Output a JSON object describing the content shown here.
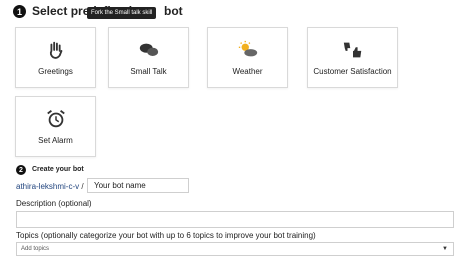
{
  "step1": {
    "number": "1",
    "title_start": "Select predefined",
    "title_end": "bot",
    "tooltip": "Fork the Small talk skill"
  },
  "cards": [
    {
      "label": "Greetings",
      "icon": "waving-hand-icon"
    },
    {
      "label": "Small Talk",
      "icon": "chat-bubbles-icon"
    },
    {
      "label": "Weather",
      "icon": "weather-icon"
    },
    {
      "label": "Customer Satisfaction",
      "icon": "thumbs-up-down-icon"
    },
    {
      "label": "Set Alarm",
      "icon": "alarm-clock-icon"
    }
  ],
  "step2": {
    "number": "2",
    "title": "Create your bot"
  },
  "repo": {
    "owner": "athira-lekshmi-c-v",
    "separator": "/"
  },
  "bot_name": {
    "value": "Your bot name"
  },
  "description": {
    "label": "Description (optional)",
    "value": ""
  },
  "topics": {
    "label": "Topics (optionally categorize your bot with up to 6 topics to improve your bot training)",
    "placeholder": "Add topics"
  }
}
